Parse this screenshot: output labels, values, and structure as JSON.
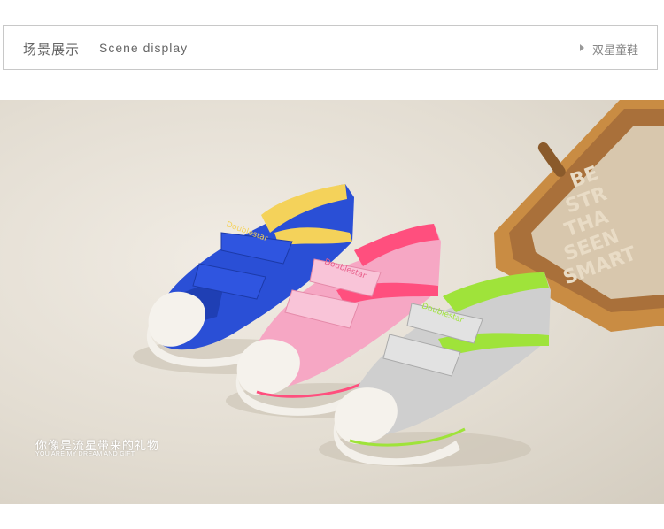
{
  "header": {
    "title_cn": "场景展示",
    "title_en": "Scene display",
    "brand": "双星童鞋"
  },
  "scene": {
    "caption_cn": "你像是流星带来的礼物",
    "caption_en": "YOU ARE MY DREAM AND GIFT",
    "crate_text": [
      "BE",
      "STR",
      "THA",
      "SEEN",
      "SMART"
    ],
    "colors": {
      "blue_shoe": "#2a4fd6",
      "pink_shoe": "#f6a7c4",
      "grey_shoe": "#cfcfcf",
      "yellow_trim": "#f4d25a",
      "pink_trim": "#ff4f7e",
      "green_trim": "#9fe33a",
      "crate": "#c98c43"
    }
  }
}
